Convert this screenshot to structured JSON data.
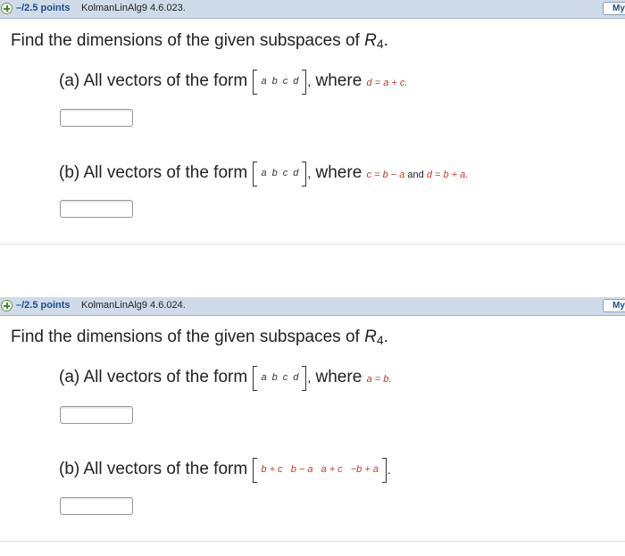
{
  "problems": [
    {
      "points": "–/2.5 points",
      "id": "KolmanLinAlg9 4.6.023.",
      "notes_label": "My",
      "title_prefix": "Find the dimensions of the given subspaces of ",
      "title_R": "R",
      "title_sub": "4",
      "title_suffix": ".",
      "parts": [
        {
          "label": "(a) All vectors of the form",
          "vector": [
            "a",
            "b",
            "c",
            "d"
          ],
          "comma": ",",
          "where": "where",
          "condition": "d = a + c.",
          "answer": ""
        },
        {
          "label": "(b) All vectors of the form",
          "vector": [
            "a",
            "b",
            "c",
            "d"
          ],
          "comma": ",",
          "where": "where",
          "condition_1": "c = b − a",
          "and": "and",
          "condition_2": "d = b + a.",
          "answer": ""
        }
      ]
    },
    {
      "points": "–/2.5 points",
      "id": "KolmanLinAlg9 4.6.024.",
      "notes_label": "My",
      "title_prefix": "Find the dimensions of the given subspaces of ",
      "title_R": "R",
      "title_sub": "4",
      "title_suffix": ".",
      "parts": [
        {
          "label": "(a) All vectors of the form",
          "vector": [
            "a",
            "b",
            "c",
            "d"
          ],
          "comma": ",",
          "where": "where",
          "condition": "a = b.",
          "answer": ""
        },
        {
          "label": "(b) All vectors of the form",
          "vector": [
            "b + c",
            "b − a",
            "a + c",
            "−b + a"
          ],
          "period": ".",
          "answer": ""
        }
      ]
    }
  ],
  "colors": {
    "header_bg": "#cfdbe9",
    "points_text": "#1b4d8c",
    "condition_text": "#c0392b"
  }
}
